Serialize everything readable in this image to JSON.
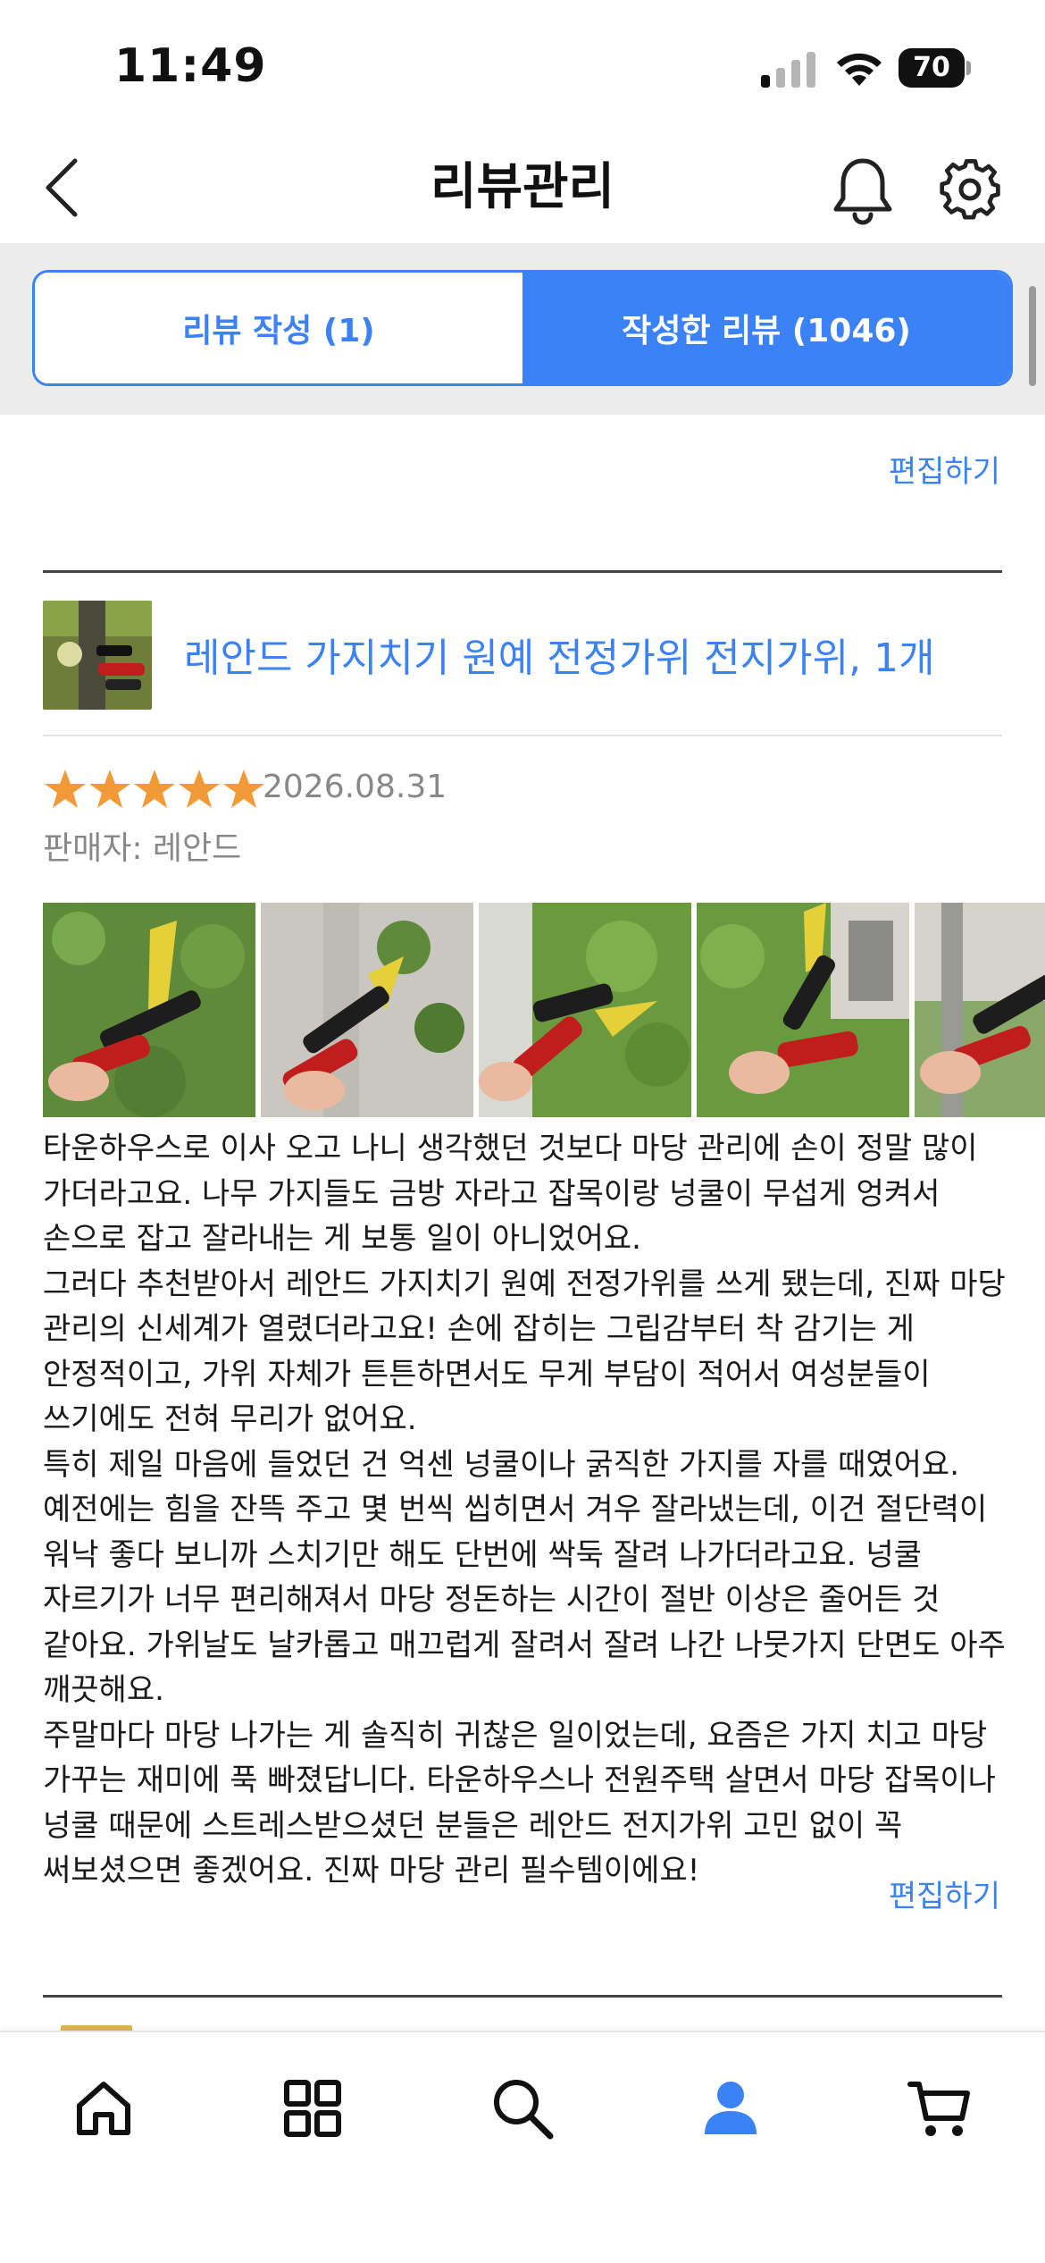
{
  "status_bar": {
    "time": "11:49",
    "battery": "70"
  },
  "header": {
    "title": "리뷰관리",
    "back_icon": "chevron-left-icon",
    "notification_icon": "bell-icon",
    "settings_icon": "gear-icon"
  },
  "tabs": [
    {
      "label": "리뷰 작성 (1)",
      "active": false
    },
    {
      "label": "작성한 리뷰 (1046)",
      "active": true
    }
  ],
  "colors": {
    "accent": "#3b82f6",
    "star": "#f29a38",
    "muted_text": "#888888"
  },
  "top_edit_label": "편집하기",
  "review": {
    "product_title": "레안드 가지치기 원예 전정가위 전지가위, 1개",
    "rating": 5,
    "max_rating": 5,
    "date": "2026.08.31",
    "seller": "판매자: 레안드",
    "photo_count_visible": 5,
    "body": "타운하우스로 이사 오고 나니 생각했던 것보다 마당 관리에 손이 정말 많이 가더라고요. 나무 가지들도 금방 자라고 잡목이랑 넝쿨이 무섭게 엉켜서 손으로 잡고 잘라내는 게 보통 일이 아니었어요.\n그러다 추천받아서 레안드 가지치기 원예 전정가위를 쓰게 됐는데, 진짜 마당 관리의 신세계가 열렸더라고요! 손에 잡히는 그립감부터 착 감기는 게 안정적이고, 가위 자체가 튼튼하면서도 무게 부담이 적어서 여성분들이 쓰기에도 전혀 무리가 없어요.\n특히 제일 마음에 들었던 건 억센 넝쿨이나 굵직한 가지를 자를 때였어요. 예전에는 힘을 잔뜩 주고 몇 번씩 씹히면서 겨우 잘라냈는데, 이건 절단력이 워낙 좋다 보니까 스치기만 해도 단번에 싹둑 잘려 나가더라고요. 넝쿨 자르기가 너무 편리해져서 마당 정돈하는 시간이 절반 이상은 줄어든 것 같아요. 가위날도 날카롭고 매끄럽게 잘려서 잘려 나간 나뭇가지 단면도 아주 깨끗해요.\n주말마다 마당 나가는 게 솔직히 귀찮은 일이었는데, 요즘은 가지 치고 마당 가꾸는 재미에 푹 빠졌답니다. 타운하우스나 전원주택 살면서 마당 잡목이나 넝쿨 때문에 스트레스받으셨던 분들은 레안드 전지가위 고민 없이 꼭 써보셨으면 좋겠어요. 진짜 마당 관리 필수템이에요!",
    "edit_label": "편집하기"
  },
  "bottom_nav": [
    {
      "icon": "home-icon",
      "active": false
    },
    {
      "icon": "grid-icon",
      "active": false
    },
    {
      "icon": "search-icon",
      "active": false
    },
    {
      "icon": "person-icon",
      "active": true
    },
    {
      "icon": "cart-icon",
      "active": false
    }
  ]
}
